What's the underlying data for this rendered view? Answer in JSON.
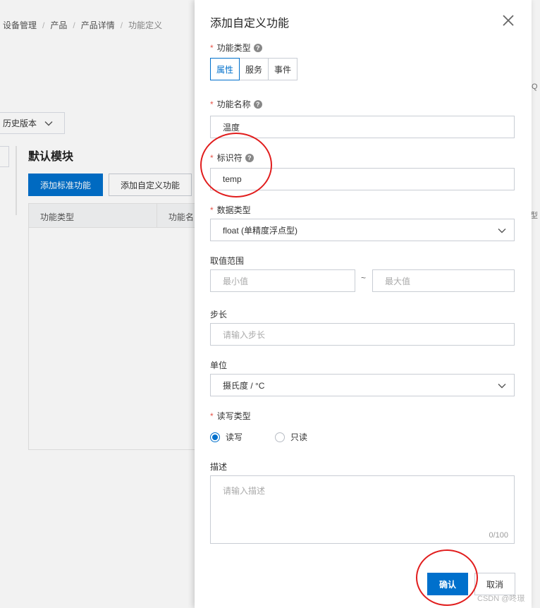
{
  "background": {
    "breadcrumb": [
      "设备管理",
      "产品",
      "产品详情",
      "功能定义"
    ],
    "version_select": "历史版本",
    "module_title": "默认模块",
    "add_standard_label": "添加标准功能",
    "add_custom_label": "添加自定义功能",
    "table_headers": [
      "功能类型",
      "功能名"
    ],
    "right_peek_q": "Q",
    "right_peek_t": "型"
  },
  "drawer": {
    "title": "添加自定义功能",
    "function_type": {
      "label": "功能类型",
      "options": [
        "属性",
        "服务",
        "事件"
      ],
      "selected": "属性"
    },
    "function_name": {
      "label": "功能名称",
      "value": "温度"
    },
    "identifier": {
      "label": "标识符",
      "value": "temp"
    },
    "data_type": {
      "label": "数据类型",
      "value": "float (单精度浮点型)"
    },
    "value_range": {
      "label": "取值范围",
      "min_placeholder": "最小值",
      "separator": "~",
      "max_placeholder": "最大值"
    },
    "step": {
      "label": "步长",
      "placeholder": "请输入步长"
    },
    "unit": {
      "label": "单位",
      "value": "摄氏度 / °C"
    },
    "rw_type": {
      "label": "读写类型",
      "options": [
        "读写",
        "只读"
      ],
      "selected": "读写"
    },
    "description": {
      "label": "描述",
      "placeholder": "请输入描述",
      "counter": "0/100"
    },
    "confirm_label": "确认",
    "cancel_label": "取消"
  },
  "watermark": "CSDN @咚璟",
  "colors": {
    "primary": "#0070cc",
    "required": "#e6564b",
    "annotation": "#e11d1d"
  }
}
